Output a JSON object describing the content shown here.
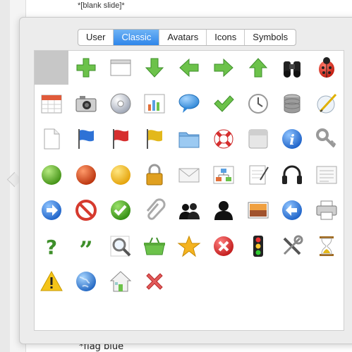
{
  "background": {
    "top_text": "*[blank slide]*",
    "bottom_text": "*flag blue"
  },
  "tabs": [
    {
      "label": "User",
      "active": false
    },
    {
      "label": "Classic",
      "active": true
    },
    {
      "label": "Avatars",
      "active": false
    },
    {
      "label": "Icons",
      "active": false
    },
    {
      "label": "Symbols",
      "active": false
    }
  ],
  "icons": [
    [
      "blank-icon",
      "plus-icon",
      "window-icon",
      "arrow-down-icon",
      "arrow-left-icon",
      "arrow-right-icon",
      "arrow-up-icon",
      "binoculars-icon",
      "bug-icon"
    ],
    [
      "calendar-icon",
      "camera-icon",
      "cd-icon",
      "chart-icon",
      "speech-bubble-icon",
      "checkmark-icon",
      "clock-icon",
      "database-icon",
      "compass-icon"
    ],
    [
      "document-icon",
      "flag-blue-icon",
      "flag-red-icon",
      "flag-yellow-icon",
      "folder-icon",
      "lifebuoy-icon",
      "paper-icon",
      "info-icon",
      "key-icon"
    ],
    [
      "circle-green-icon",
      "circle-red-icon",
      "circle-yellow-icon",
      "lock-icon",
      "mail-icon",
      "network-icon",
      "notepad-icon",
      "headphones-icon",
      "list-icon"
    ],
    [
      "forward-circle-icon",
      "no-entry-icon",
      "ok-circle-icon",
      "paperclip-icon",
      "users-icon",
      "user-icon",
      "photo-icon",
      "back-circle-icon",
      "printer-icon"
    ],
    [
      "question-icon",
      "quote-icon",
      "magnifier-icon",
      "basket-icon",
      "star-icon",
      "close-circle-icon",
      "traffic-light-icon",
      "tools-icon",
      "hourglass-icon"
    ],
    [
      "warning-icon",
      "globe-icon",
      "home-icon",
      "delete-x-icon"
    ]
  ],
  "colors": {
    "accent": "#2f86ea",
    "selected_cell": "#c7c7c7"
  }
}
